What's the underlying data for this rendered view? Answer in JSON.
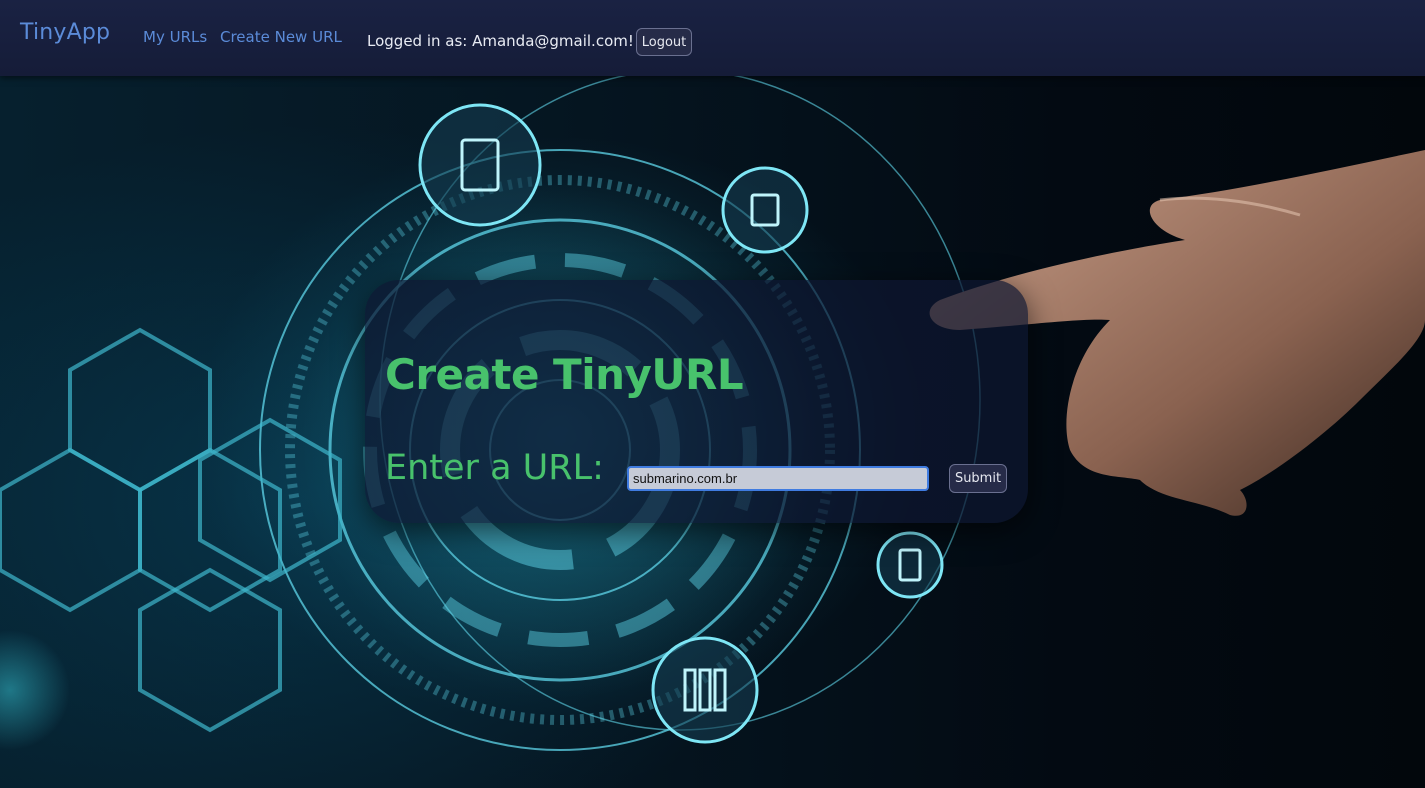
{
  "navbar": {
    "brand": "TinyApp",
    "links": [
      "My URLs",
      "Create New URL"
    ],
    "logged_in_text": "Logged in as: Amanda@gmail.com!",
    "logout_label": "Logout"
  },
  "form": {
    "title": "Create TinyURL",
    "url_label": "Enter a URL:",
    "url_value": "submarino.com.br",
    "submit_label": "Submit"
  },
  "colors": {
    "nav_bg": "#1a2243",
    "link": "#5b8bd8",
    "heading_green": "#48c26c",
    "button_bg": "#262b48"
  }
}
